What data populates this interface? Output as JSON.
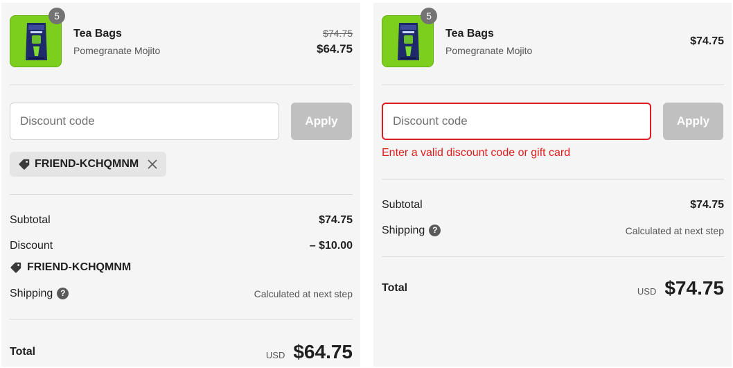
{
  "left": {
    "line_item": {
      "quantity": "5",
      "name": "Tea Bags",
      "variant": "Pomegranate Mojito",
      "compare_price": "$74.75",
      "price": "$64.75"
    },
    "discount_field": {
      "placeholder": "Discount code",
      "value": ""
    },
    "apply_label": "Apply",
    "applied_code": "FRIEND-KCHQMNM",
    "subtotal_label": "Subtotal",
    "subtotal_value": "$74.75",
    "discount_label": "Discount",
    "discount_value": "– $10.00",
    "discount_code": "FRIEND-KCHQMNM",
    "shipping_label": "Shipping",
    "shipping_value": "Calculated at next step",
    "total_label": "Total",
    "currency": "USD",
    "total_value": "$64.75"
  },
  "right": {
    "line_item": {
      "quantity": "5",
      "name": "Tea Bags",
      "variant": "Pomegranate Mojito",
      "price": "$74.75"
    },
    "discount_field": {
      "placeholder": "Discount code",
      "value": ""
    },
    "apply_label": "Apply",
    "error_message": "Enter a valid discount code or gift card",
    "subtotal_label": "Subtotal",
    "subtotal_value": "$74.75",
    "shipping_label": "Shipping",
    "shipping_value": "Calculated at next step",
    "total_label": "Total",
    "currency": "USD",
    "total_value": "$74.75"
  },
  "colors": {
    "error": "#dd1d1d",
    "thumbnail_bg": "#7ccf1d",
    "panel_bg": "#f5f5f5",
    "button_disabled": "#c0c0c0"
  },
  "icons": {
    "tag": "tag-icon",
    "remove": "close-icon",
    "help": "question-circle-icon"
  }
}
